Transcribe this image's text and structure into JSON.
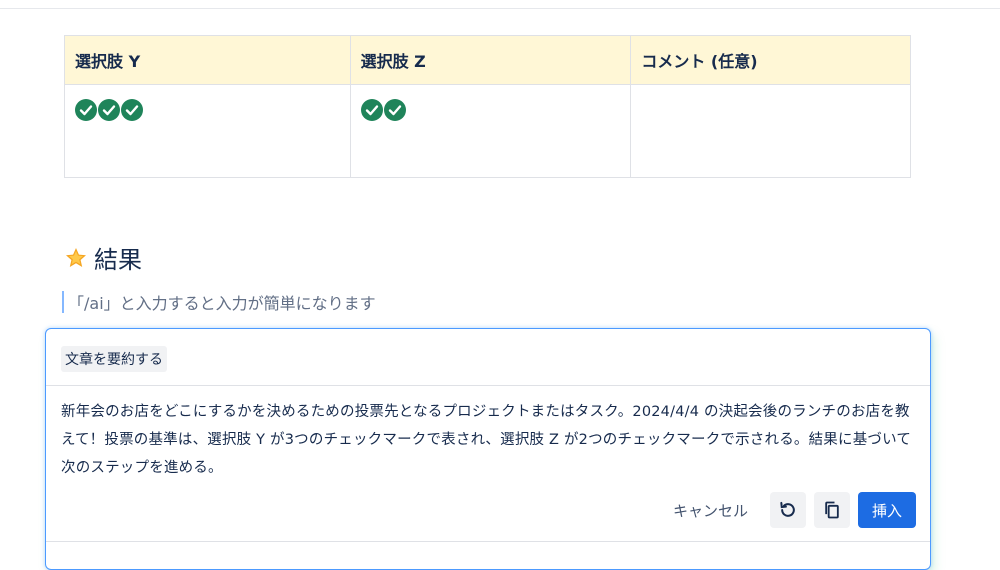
{
  "table": {
    "headers": [
      "選択肢 Y",
      "選択肢 Z",
      "コメント (任意)"
    ],
    "rows": [
      {
        "option_y_checks": 3,
        "option_z_checks": 2,
        "comment": ""
      }
    ]
  },
  "colors": {
    "check": "#1f845a",
    "header_bg": "#fff7d6",
    "insert_button": "#1d6ce3"
  },
  "section": {
    "title": "結果",
    "icon": "star-icon"
  },
  "editor": {
    "placeholder": "「/ai」と入力すると入力が簡単になります"
  },
  "ai_panel": {
    "prompt": "文章を要約する",
    "result": "新年会のお店をどこにするかを決めるための投票先となるプロジェクトまたはタスク。2024/4/4 の決起会後のランチのお店を教えて！投票の基準は、選択肢 Y が3つのチェックマークで表され、選択肢 Z が2つのチェックマークで示される。結果に基づいて次のステップを進める。",
    "cancel_label": "キャンセル",
    "retry_icon": "retry-icon",
    "copy_icon": "copy-icon",
    "insert_label": "挿入"
  }
}
